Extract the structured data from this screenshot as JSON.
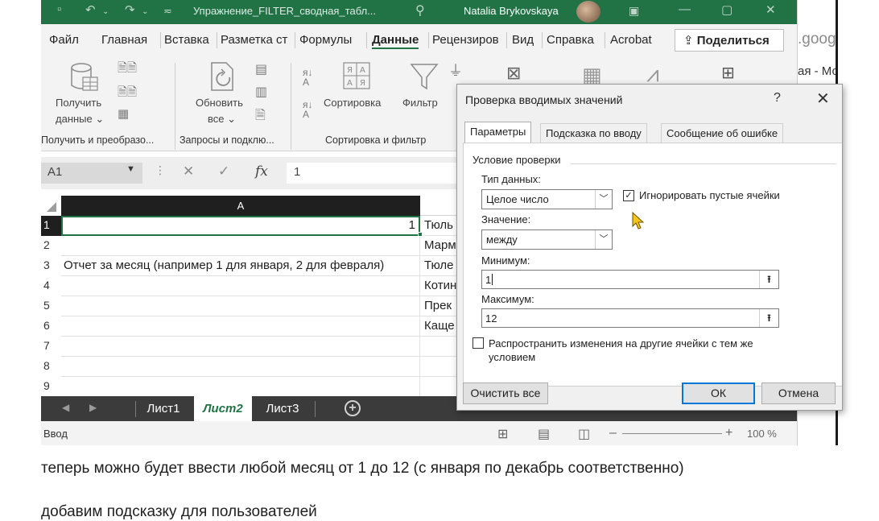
{
  "excel": {
    "title": "Упражнение_FILTER_сводная_табл...",
    "user": "Natalia Brykovskaya",
    "menu": [
      "Файл",
      "Главная",
      "Вставка",
      "Разметка ст",
      "Формулы",
      "Данные",
      "Рецензиров",
      "Вид",
      "Справка",
      "Acrobat"
    ],
    "share_label": "Поделиться",
    "ribbon": {
      "get_data_line1": "Получить",
      "get_data_line2": "данные",
      "refresh_line1": "Обновить",
      "refresh_line2": "все",
      "sort_label": "Сортировка",
      "filter_label": "Фильтр",
      "group1": "Получить и преобразо...",
      "group2": "Запросы и подклю...",
      "group3": "Сортировка и фильтр"
    },
    "name_box": "A1",
    "formula_value": "1",
    "column_a": "A",
    "rows": [
      {
        "num": "1",
        "a": "1",
        "b": "Тюль"
      },
      {
        "num": "2",
        "a": "",
        "b": "Марм"
      },
      {
        "num": "3",
        "a": "Отчет за месяц (например 1 для января, 2 для февраля)",
        "b": "Тюле"
      },
      {
        "num": "4",
        "a": "",
        "b": "Котин"
      },
      {
        "num": "5",
        "a": "",
        "b": "Прек"
      },
      {
        "num": "6",
        "a": "",
        "b": "Каще"
      },
      {
        "num": "7",
        "a": "",
        "b": ""
      },
      {
        "num": "8",
        "a": "",
        "b": ""
      },
      {
        "num": "9",
        "a": "",
        "b": ""
      }
    ],
    "sheets": [
      "Лист1",
      "Лист2",
      "Лист3"
    ],
    "active_sheet": "Лист2",
    "status": "Ввод",
    "zoom": "100 %"
  },
  "browser": {
    "url_fragment": ".goog",
    "tab_fragment": "ая - Мо"
  },
  "dialog": {
    "title": "Проверка вводимых значений",
    "help": "?",
    "close": "✕",
    "tabs": [
      "Параметры",
      "Подсказка по вводу",
      "Сообщение об ошибке"
    ],
    "section": "Условие проверки",
    "data_type_label": "Тип данных:",
    "data_type_value": "Целое число",
    "ignore_blank_label": "Игнорировать пустые ячейки",
    "ignore_blank_checked": true,
    "value_label": "Значение:",
    "value_value": "между",
    "min_label": "Минимум:",
    "min_value": "1",
    "max_label": "Максимум:",
    "max_value": "12",
    "apply_all_label": "Распространить изменения на другие ячейки с тем же",
    "apply_all_label2": "условием",
    "apply_all_checked": false,
    "clear_all": "Очистить все",
    "ok": "ОК",
    "cancel": "Отмена"
  },
  "captions": [
    "теперь можно будет ввести любой месяц от 1 до 12 (с января по декабрь соответственно)",
    "добавим подсказку для пользователей"
  ],
  "colors": {
    "excel_green": "#217346",
    "dialog_focus": "#0078d7",
    "cursor_yellow": "#f5c518"
  }
}
